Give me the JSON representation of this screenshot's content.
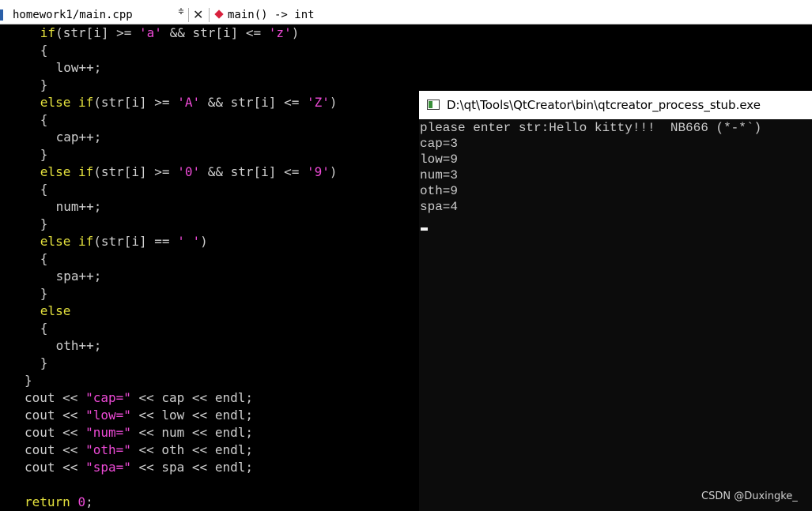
{
  "top_strip": {
    "text": ""
  },
  "toolbar": {
    "file_name": "homework1/main.cpp",
    "file_arrows": "≑",
    "close_glyph": "✕",
    "function_name": "main() -> int",
    "file_icon": "document-icon",
    "function_icon": "function-icon"
  },
  "code": {
    "lines": [
      {
        "indent": 4,
        "tokens": [
          [
            "kw",
            "if"
          ],
          [
            "op",
            "(str[i] >= "
          ],
          [
            "str",
            "'a'"
          ],
          [
            "op",
            " && str[i] <= "
          ],
          [
            "str",
            "'z'"
          ],
          [
            "op",
            ")"
          ]
        ]
      },
      {
        "indent": 4,
        "tokens": [
          [
            "op",
            "{"
          ]
        ]
      },
      {
        "indent": 6,
        "tokens": [
          [
            "op",
            "low++;"
          ]
        ]
      },
      {
        "indent": 4,
        "tokens": [
          [
            "op",
            "}"
          ]
        ]
      },
      {
        "indent": 4,
        "tokens": [
          [
            "kw",
            "else if"
          ],
          [
            "op",
            "(str[i] >= "
          ],
          [
            "str",
            "'A'"
          ],
          [
            "op",
            " && str[i] <= "
          ],
          [
            "str",
            "'Z'"
          ],
          [
            "op",
            ")"
          ]
        ]
      },
      {
        "indent": 4,
        "tokens": [
          [
            "op",
            "{"
          ]
        ]
      },
      {
        "indent": 6,
        "tokens": [
          [
            "op",
            "cap++;"
          ]
        ]
      },
      {
        "indent": 4,
        "tokens": [
          [
            "op",
            "}"
          ]
        ]
      },
      {
        "indent": 4,
        "tokens": [
          [
            "kw",
            "else if"
          ],
          [
            "op",
            "(str[i] >= "
          ],
          [
            "str",
            "'0'"
          ],
          [
            "op",
            " && str[i] <= "
          ],
          [
            "str",
            "'9'"
          ],
          [
            "op",
            ")"
          ]
        ]
      },
      {
        "indent": 4,
        "tokens": [
          [
            "op",
            "{"
          ]
        ]
      },
      {
        "indent": 6,
        "tokens": [
          [
            "op",
            "num++;"
          ]
        ]
      },
      {
        "indent": 4,
        "tokens": [
          [
            "op",
            "}"
          ]
        ]
      },
      {
        "indent": 4,
        "tokens": [
          [
            "kw",
            "else if"
          ],
          [
            "op",
            "(str[i] == "
          ],
          [
            "str",
            "' '"
          ],
          [
            "op",
            ")"
          ]
        ]
      },
      {
        "indent": 4,
        "tokens": [
          [
            "op",
            "{"
          ]
        ]
      },
      {
        "indent": 6,
        "tokens": [
          [
            "op",
            "spa++;"
          ]
        ]
      },
      {
        "indent": 4,
        "tokens": [
          [
            "op",
            "}"
          ]
        ]
      },
      {
        "indent": 4,
        "tokens": [
          [
            "kw",
            "else"
          ]
        ]
      },
      {
        "indent": 4,
        "tokens": [
          [
            "op",
            "{"
          ]
        ]
      },
      {
        "indent": 6,
        "tokens": [
          [
            "op",
            "oth++;"
          ]
        ]
      },
      {
        "indent": 4,
        "tokens": [
          [
            "op",
            "}"
          ]
        ]
      },
      {
        "indent": 2,
        "tokens": [
          [
            "op",
            "}"
          ]
        ]
      },
      {
        "indent": 2,
        "tokens": [
          [
            "op",
            "cout << "
          ],
          [
            "str",
            "\"cap=\""
          ],
          [
            "op",
            " << cap << endl;"
          ]
        ]
      },
      {
        "indent": 2,
        "tokens": [
          [
            "op",
            "cout << "
          ],
          [
            "str",
            "\"low=\""
          ],
          [
            "op",
            " << low << endl;"
          ]
        ]
      },
      {
        "indent": 2,
        "tokens": [
          [
            "op",
            "cout << "
          ],
          [
            "str",
            "\"num=\""
          ],
          [
            "op",
            " << num << endl;"
          ]
        ]
      },
      {
        "indent": 2,
        "tokens": [
          [
            "op",
            "cout << "
          ],
          [
            "str",
            "\"oth=\""
          ],
          [
            "op",
            " << oth << endl;"
          ]
        ]
      },
      {
        "indent": 2,
        "tokens": [
          [
            "op",
            "cout << "
          ],
          [
            "str",
            "\"spa=\""
          ],
          [
            "op",
            " << spa << endl;"
          ]
        ]
      },
      {
        "indent": 0,
        "tokens": []
      },
      {
        "indent": 2,
        "tokens": [
          [
            "kw",
            "return"
          ],
          [
            "op",
            " "
          ],
          [
            "num",
            "0"
          ],
          [
            "op",
            ";"
          ]
        ]
      }
    ]
  },
  "console": {
    "title": "D:\\qt\\Tools\\QtCreator\\bin\\qtcreator_process_stub.exe",
    "icon": "console-app-icon",
    "output": [
      "please enter str:Hello kitty!!!  NB666 (*-*`)",
      "cap=3",
      "low=9",
      "num=3",
      "oth=9",
      "spa=4"
    ]
  },
  "watermark": "CSDN @Duxingke_",
  "colors": {
    "editor_bg": "#000000",
    "keyword": "#e5e23e",
    "string": "#ee4ad7",
    "text": "#cfcfcf",
    "console_bg": "#0c0c0c",
    "console_text": "#cccccc"
  }
}
